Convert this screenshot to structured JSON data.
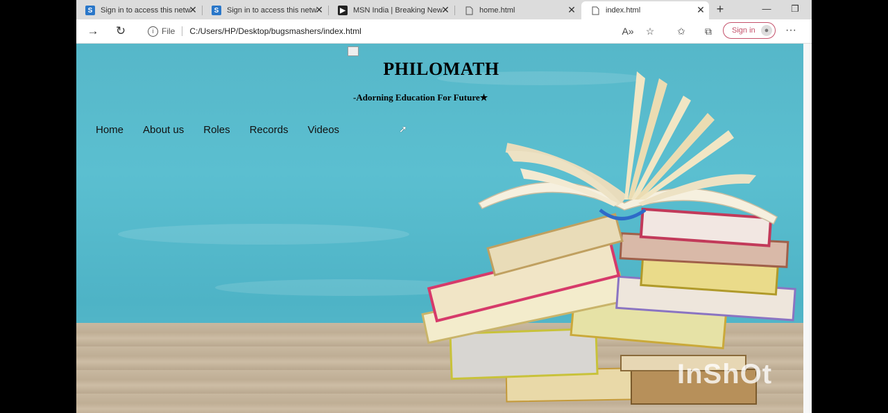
{
  "browser": {
    "tabs": [
      {
        "title": "Sign in to access this netw",
        "icon": "s-logo-icon"
      },
      {
        "title": "Sign in to access this netw",
        "icon": "s-logo-icon"
      },
      {
        "title": "MSN India | Breaking New",
        "icon": "msn-icon"
      },
      {
        "title": "home.html",
        "icon": "document-icon"
      },
      {
        "title": "index.html",
        "icon": "document-icon",
        "active": true
      }
    ],
    "address": {
      "scheme_label": "File",
      "url": "C:/Users/HP/Desktop/bugsmashers/index.html"
    },
    "signin_label": "Sign in"
  },
  "page": {
    "title": "PHILOMATH",
    "subtitle": "-Adorning Education For Future",
    "subtitle_star": "★",
    "nav": [
      "Home",
      "About us",
      "Roles",
      "Records",
      "Videos"
    ]
  },
  "overlay": {
    "watermark": "InShOt"
  }
}
